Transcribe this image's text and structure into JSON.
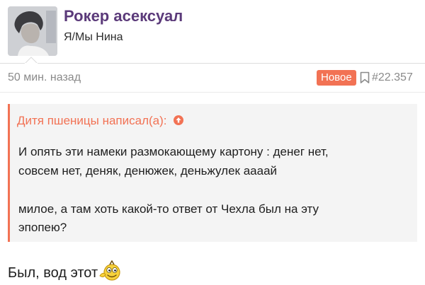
{
  "post": {
    "author_name": "Рокер асексуал",
    "author_title": "Я/Мы Нина",
    "time_ago": "50 мин. назад",
    "new_badge": "Новое",
    "post_number": "#22.357"
  },
  "quote": {
    "header": "Дитя пшеницы написал(а):",
    "lines": [
      "И опять эти намеки размокающему картону : денег нет,",
      "совсем нет, деняк, денюжек, деньжулек аааай",
      "милое, а там хоть какой-то ответ от Чехла был на эту",
      "эпопею?"
    ]
  },
  "reply": {
    "text": "Был, вод этот"
  },
  "colors": {
    "accent": "#f27254",
    "username": "#5b3a7a",
    "muted": "#8a8a8a",
    "quote_bg": "#f4f4f4"
  },
  "icons": {
    "avatar": "avatar",
    "bookmark": "bookmark-icon",
    "quote_jump": "arrow-up-circle-icon",
    "emoji": "smiley-icon"
  }
}
